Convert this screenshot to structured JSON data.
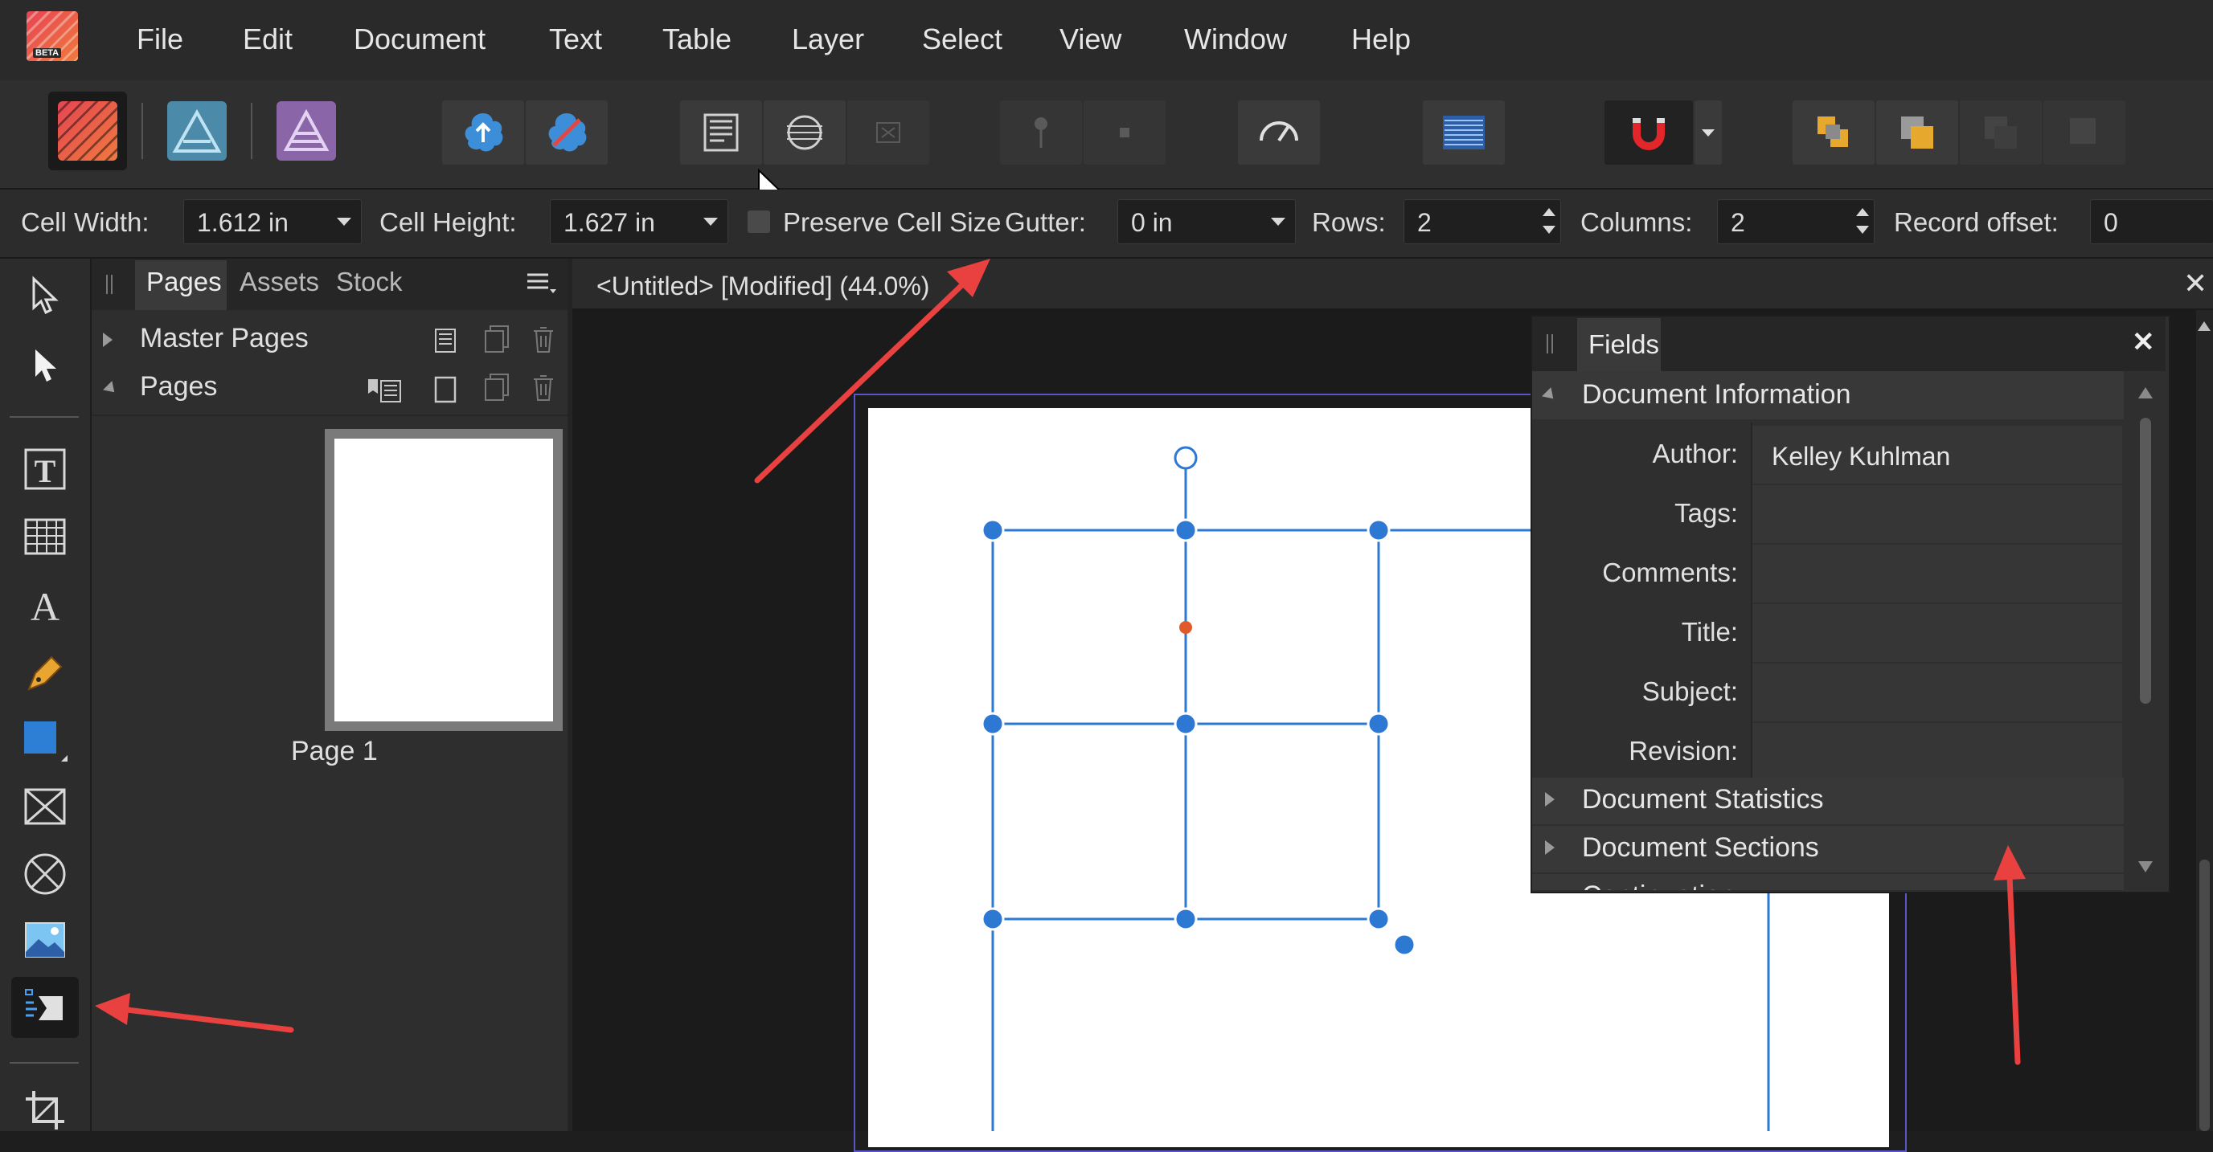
{
  "menu": {
    "items": [
      "File",
      "Edit",
      "Document",
      "Text",
      "Table",
      "Layer",
      "Select",
      "View",
      "Window",
      "Help"
    ],
    "logo_badge": "BETA"
  },
  "toolbar": {
    "personas": [
      "publisher-persona",
      "designer-persona",
      "photo-persona"
    ],
    "buttons": [
      "upload-icon",
      "resource-icon",
      "text-frame-icon",
      "shape-frame-icon",
      "frame-x-icon",
      "pin-icon",
      "square-icon",
      "preflight-icon",
      "baseline-grid-icon",
      "snapping-magnet-icon",
      "arrange-icons"
    ]
  },
  "context": {
    "cell_width_label": "Cell Width:",
    "cell_width_value": "1.612 in",
    "cell_height_label": "Cell Height:",
    "cell_height_value": "1.627 in",
    "preserve_label": "Preserve Cell Size",
    "gutter_label": "Gutter:",
    "gutter_value": "0 in",
    "rows_label": "Rows:",
    "rows_value": "2",
    "columns_label": "Columns:",
    "columns_value": "2",
    "record_offset_label": "Record offset:",
    "record_offset_value": "0"
  },
  "pages_panel": {
    "tabs": [
      "Pages",
      "Assets",
      "Stock"
    ],
    "active_tab": "Pages",
    "master_pages_label": "Master Pages",
    "pages_label": "Pages",
    "page_label": "Page 1"
  },
  "document": {
    "tab_title": "<Untitled> [Modified] (44.0%)"
  },
  "fields_panel": {
    "title": "Fields",
    "section_open": "Document Information",
    "fields": [
      {
        "label": "Author:",
        "value": "Kelley Kuhlman"
      },
      {
        "label": "Tags:",
        "value": ""
      },
      {
        "label": "Comments:",
        "value": ""
      },
      {
        "label": "Title:",
        "value": ""
      },
      {
        "label": "Subject:",
        "value": ""
      },
      {
        "label": "Revision:",
        "value": ""
      }
    ],
    "collapsed_sections": [
      "Document Statistics",
      "Document Sections",
      "Continuation"
    ]
  },
  "colors": {
    "accent_blue": "#2d78d2",
    "arrow_red": "#e8413f",
    "handle_orange": "#e05a2b",
    "page_outline": "#5a55c8"
  }
}
